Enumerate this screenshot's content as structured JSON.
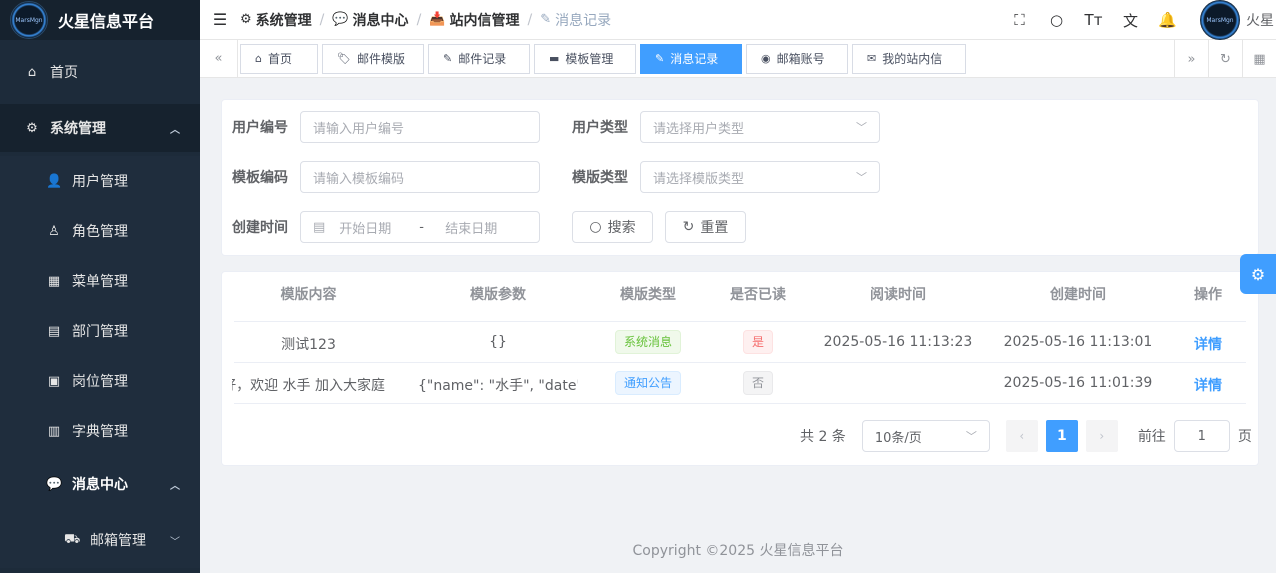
{
  "app": {
    "title": "火星信息平台",
    "logo_text": "MarsMgn"
  },
  "sidebar": {
    "items": [
      {
        "label": "首页",
        "icon": "home-icon"
      },
      {
        "label": "系统管理",
        "icon": "gear-icon"
      },
      {
        "label": "用户管理",
        "icon": "user-icon"
      },
      {
        "label": "角色管理",
        "icon": "user-outline-icon"
      },
      {
        "label": "菜单管理",
        "icon": "grid-icon"
      },
      {
        "label": "部门管理",
        "icon": "id-card-icon"
      },
      {
        "label": "岗位管理",
        "icon": "badge-icon"
      },
      {
        "label": "字典管理",
        "icon": "book-icon"
      },
      {
        "label": "消息中心",
        "icon": "chat-icon"
      },
      {
        "label": "邮箱管理",
        "icon": "mailbox-icon"
      }
    ]
  },
  "breadcrumb": [
    {
      "label": "系统管理"
    },
    {
      "label": "消息中心"
    },
    {
      "label": "站内信管理"
    },
    {
      "label": "消息记录"
    }
  ],
  "navbar": {
    "username": "火星"
  },
  "tags": [
    {
      "label": "首页"
    },
    {
      "label": "邮件模版"
    },
    {
      "label": "邮件记录"
    },
    {
      "label": "模板管理"
    },
    {
      "label": "消息记录"
    },
    {
      "label": "邮箱账号"
    },
    {
      "label": "我的站内信"
    }
  ],
  "search": {
    "user_id_label": "用户编号",
    "user_id_placeholder": "请输入用户编号",
    "user_type_label": "用户类型",
    "user_type_placeholder": "请选择用户类型",
    "template_code_label": "模板编码",
    "template_code_placeholder": "请输入模板编码",
    "template_type_label": "模版类型",
    "template_type_placeholder": "请选择模版类型",
    "created_label": "创建时间",
    "start_placeholder": "开始日期",
    "range_sep": "-",
    "end_placeholder": "结束日期",
    "search_btn": "搜索",
    "reset_btn": "重置"
  },
  "table": {
    "headers": [
      "模版内容",
      "模版参数",
      "模版类型",
      "是否已读",
      "阅读时间",
      "创建时间",
      "操作"
    ],
    "rows": [
      {
        "content": "测试123",
        "params": "{}",
        "type": "系统消息",
        "read": "是",
        "read_time": "2025-05-16 11:13:23",
        "created": "2025-05-16 11:13:01",
        "action": "详情"
      },
      {
        "content": "大家好，欢迎 水手 加入大家庭",
        "params": "{\"name\": \"水手\", \"date\": …",
        "type": "通知公告",
        "read": "否",
        "read_time": "",
        "created": "2025-05-16 11:01:39",
        "action": "详情"
      }
    ]
  },
  "pagination": {
    "total": "共 2 条",
    "page_size": "10条/页",
    "current": "1",
    "goto_label": "前往",
    "goto_value": "1",
    "page_unit": "页"
  },
  "footer": "Copyright ©2025 火星信息平台",
  "colors": {
    "primary": "#409eff",
    "sidebar": "#1d2b3a",
    "success": "#67c23a",
    "danger": "#f56c6c"
  }
}
